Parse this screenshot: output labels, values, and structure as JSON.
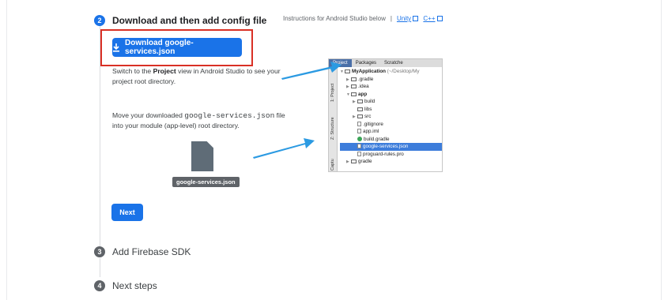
{
  "steps": [
    {
      "number": "2",
      "title": "Download and then add config file"
    },
    {
      "number": "3",
      "title": "Add Firebase SDK"
    },
    {
      "number": "4",
      "title": "Next steps"
    }
  ],
  "instructions": {
    "text": "Instructions for Android Studio below",
    "separator": "|",
    "unity_link": "Unity",
    "cpp_link": "C++"
  },
  "download_button": "Download google-services.json",
  "switch_text": {
    "pre": "Switch to the ",
    "bold": "Project",
    "post": " view in Android Studio to see your project root directory."
  },
  "move_text": {
    "pre": "Move your downloaded ",
    "mono": "google-services.json",
    "post": " file into your module (app-level) root directory."
  },
  "file_label": "google-services.json",
  "next_button": "Next",
  "android_studio": {
    "tabs": [
      "Project",
      "Packages",
      "Scratche"
    ],
    "sidebar": [
      "1: Project",
      "Z: Structure",
      "Captu"
    ],
    "tree": [
      {
        "label": "MyApplication",
        "suffix": "(~/Desktop/My"
      },
      {
        "label": ".gradle"
      },
      {
        "label": ".idea"
      },
      {
        "label": "app"
      },
      {
        "label": "build"
      },
      {
        "label": "libs"
      },
      {
        "label": "src"
      },
      {
        "label": ".gitignore"
      },
      {
        "label": "app.iml"
      },
      {
        "label": "build.gradle"
      },
      {
        "label": "google-services.json"
      },
      {
        "label": "proguard-rules.pro"
      },
      {
        "label": "gradle"
      }
    ]
  },
  "colors": {
    "accent": "#1a73e8",
    "highlight_border": "#d93025",
    "arrow": "#2b9ae2"
  }
}
